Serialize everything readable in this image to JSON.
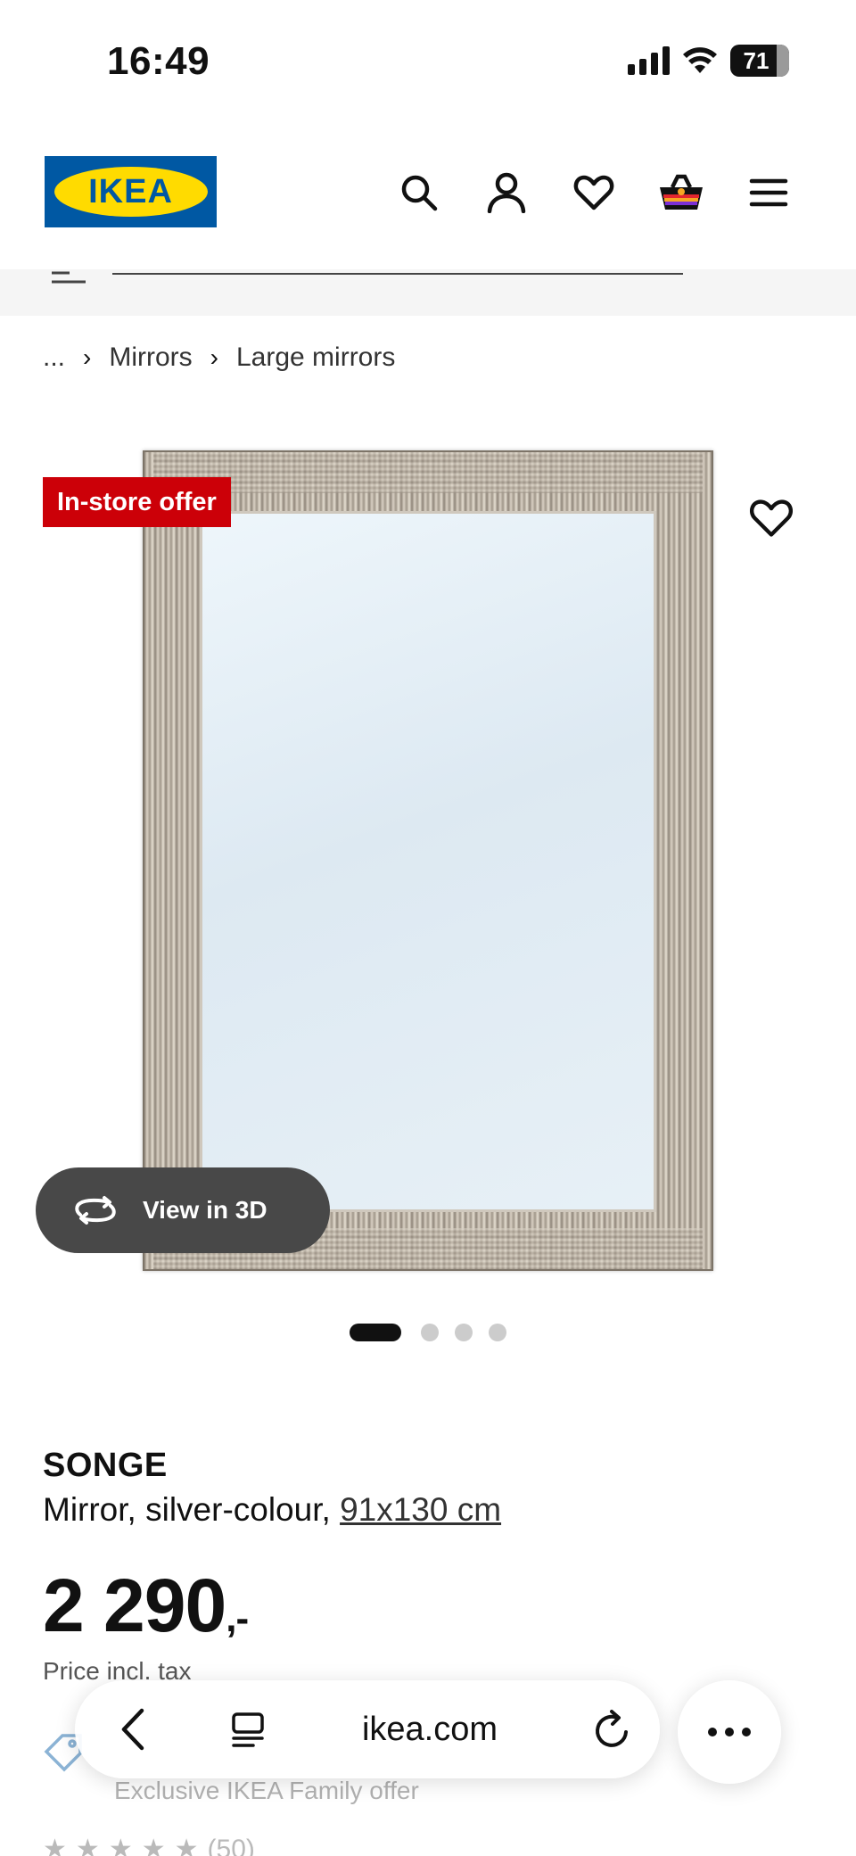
{
  "status": {
    "time": "16:49",
    "battery": "71"
  },
  "header": {
    "logo_text": "IKEA",
    "icons": [
      "search-icon",
      "account-icon",
      "heart-icon",
      "basket-icon",
      "menu-icon"
    ]
  },
  "breadcrumb": {
    "items": [
      "...",
      "Mirrors",
      "Large mirrors"
    ]
  },
  "gallery": {
    "badge": "In-store offer",
    "view3d_label": "View in 3D",
    "slide_count": 4,
    "active_slide": 1
  },
  "product": {
    "name": "SONGE",
    "description": "Mirror, silver-colour, ",
    "dimensions": "91x130 cm",
    "price": "2 290",
    "price_suffix": ",-",
    "price_note": "Price incl. tax",
    "family_offer": "Exclusive IKEA Family offer",
    "reviews_count": "(50)"
  },
  "browser": {
    "url": "ikea.com"
  },
  "colors": {
    "ikea_blue": "#0058a3",
    "ikea_yellow": "#ffdb00",
    "offer_red": "#cc0008"
  }
}
